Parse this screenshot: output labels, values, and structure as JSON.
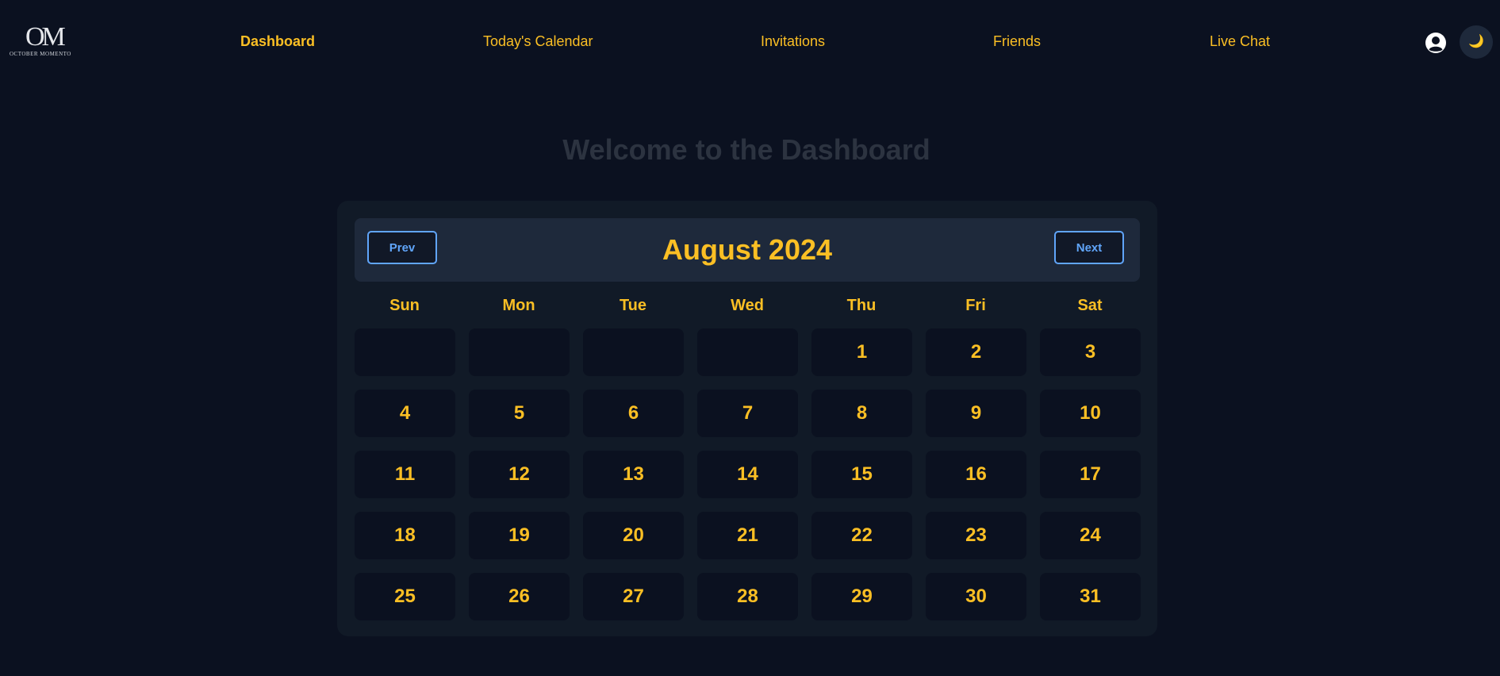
{
  "nav": {
    "logo_mark": "OM",
    "logo_text": "OCTOBER MOMENTO",
    "links": [
      {
        "label": "Dashboard",
        "active": true
      },
      {
        "label": "Today's Calendar",
        "active": false
      },
      {
        "label": "Invitations",
        "active": false
      },
      {
        "label": "Friends",
        "active": false
      },
      {
        "label": "Live Chat",
        "active": false
      }
    ],
    "profile_icon": "user-circle-icon",
    "theme_toggle_glyph": "🌙",
    "theme_toggle_icon": "moon-icon"
  },
  "page": {
    "title": "Welcome to the Dashboard"
  },
  "calendar": {
    "month_label": "August 2024",
    "prev_label": "Prev",
    "next_label": "Next",
    "weekdays": [
      "Sun",
      "Mon",
      "Tue",
      "Wed",
      "Thu",
      "Fri",
      "Sat"
    ],
    "leading_blank_days": 4,
    "days": [
      "1",
      "2",
      "3",
      "4",
      "5",
      "6",
      "7",
      "8",
      "9",
      "10",
      "11",
      "12",
      "13",
      "14",
      "15",
      "16",
      "17",
      "18",
      "19",
      "20",
      "21",
      "22",
      "23",
      "24",
      "25",
      "26",
      "27",
      "28",
      "29",
      "30",
      "31"
    ]
  },
  "colors": {
    "background": "#0b1120",
    "accent": "#fbbf24",
    "button_border": "#60a5fa",
    "panel": "#111a27",
    "header_panel": "#1e293b"
  }
}
